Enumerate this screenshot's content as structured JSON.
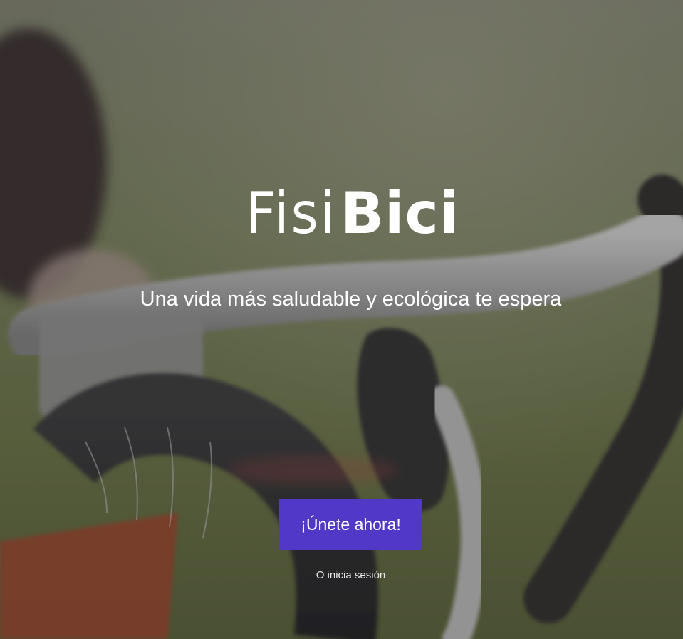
{
  "hero": {
    "background_image": "blurred photo of a bicycle handlebar with drop bars and brake lever on a grassy field",
    "logo": {
      "part1": "Fisi",
      "part2": "Bici"
    },
    "tagline": "Una vida más saludable y ecológica te espera",
    "cta_label": "¡Únete ahora!",
    "login_label": "O inicia sesión"
  },
  "colors": {
    "cta_background": "#5238c6",
    "text": "#ffffff"
  }
}
